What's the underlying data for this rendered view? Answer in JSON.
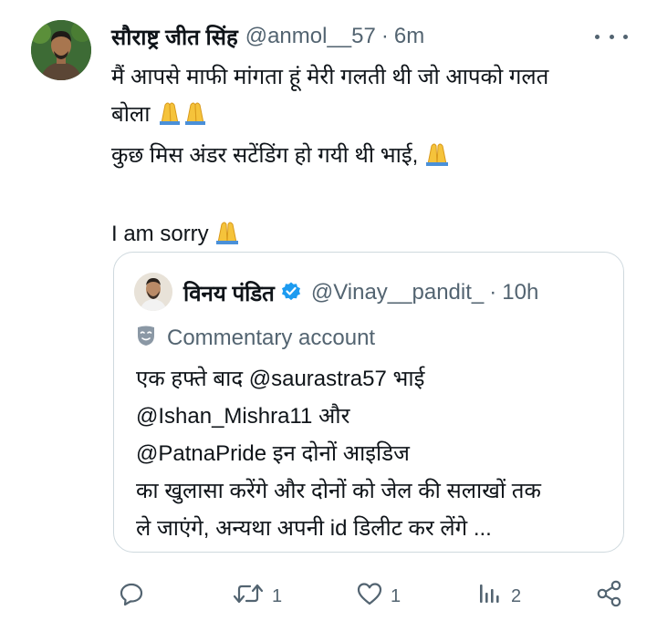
{
  "tweet": {
    "display_name": "सौराष्ट्र जीत सिंह",
    "handle": "@anmol__57",
    "separator": "·",
    "time": "6m",
    "lines": [
      "मैं आपसे माफी मांगता हूं मेरी गलती थी जो आपको गलत",
      "बोला",
      "कुछ मिस अंडर सटेंडिंग हो गयी थी भाई,",
      "I am sorry"
    ],
    "more_icon": "more-horizontal-icon"
  },
  "quote": {
    "display_name": "विनय पंडित",
    "verified_icon": "verified-badge-icon",
    "handle": "@Vinay__pandit_",
    "separator": "·",
    "time": "10h",
    "label": "Commentary account",
    "lines": [
      "एक हफ्ते बाद @saurastra57 भाई",
      "@Ishan_Mishra11 और",
      "@PatnaPride इन दोनों आइडिज",
      "का खुलासा करेंगे और दोनों को जेल की सलाखों तक",
      "ले जाएंगे, अन्यथा अपनी id डिलीट कर लेंगे ..."
    ]
  },
  "actions": {
    "reply_count": "",
    "retweet_count": "1",
    "like_count": "1",
    "views_count": "2"
  },
  "colors": {
    "text": "#0f1419",
    "secondary": "#536471",
    "border": "#cfd9de",
    "verified": "#1d9bf0"
  }
}
